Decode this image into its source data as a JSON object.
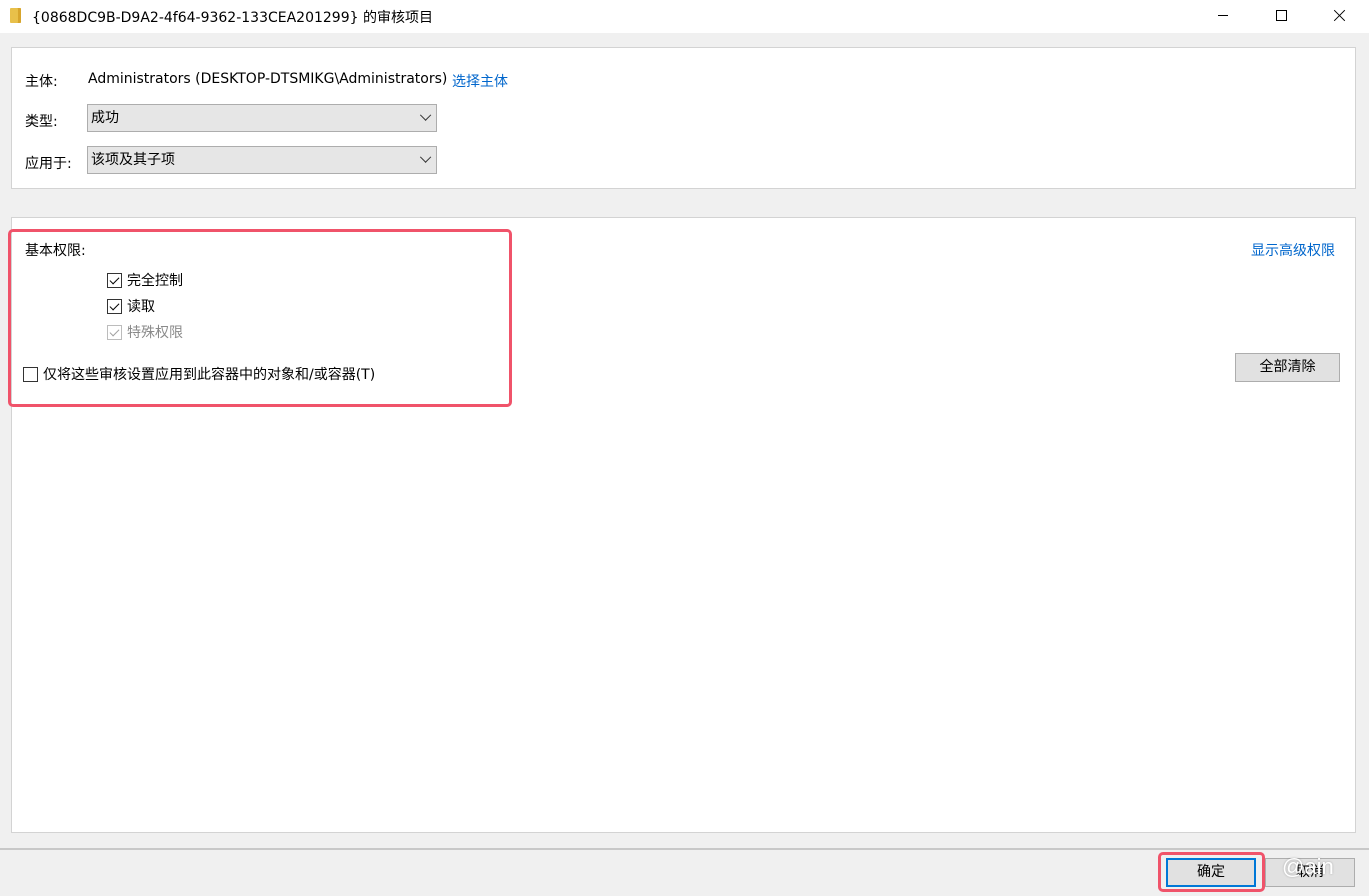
{
  "window": {
    "title": "{0868DC9B-D9A2-4f64-9362-133CEA201299} 的审核项目",
    "icon": "folder-icon"
  },
  "principal": {
    "label": "主体:",
    "value": "Administrators (DESKTOP-DTSMIKG\\Administrators)",
    "select_link": "选择主体"
  },
  "type": {
    "label": "类型:",
    "selected": "成功"
  },
  "applies_to": {
    "label": "应用于:",
    "selected": "该项及其子项"
  },
  "permissions": {
    "heading": "基本权限:",
    "show_advanced_link": "显示高级权限",
    "items": [
      {
        "label": "完全控制",
        "checked": true,
        "disabled": false
      },
      {
        "label": "读取",
        "checked": true,
        "disabled": false
      },
      {
        "label": "特殊权限",
        "checked": true,
        "disabled": true
      }
    ],
    "apply_only_container": {
      "label": "仅将这些审核设置应用到此容器中的对象和/或容器(T)",
      "checked": false
    },
    "clear_all_button": "全部清除"
  },
  "footer": {
    "ok_button": "确定",
    "cancel_button": "取消",
    "watermark": "@ain"
  },
  "colors": {
    "link": "#0066cc",
    "highlight": "#f0536a",
    "focus": "#0078d7"
  }
}
